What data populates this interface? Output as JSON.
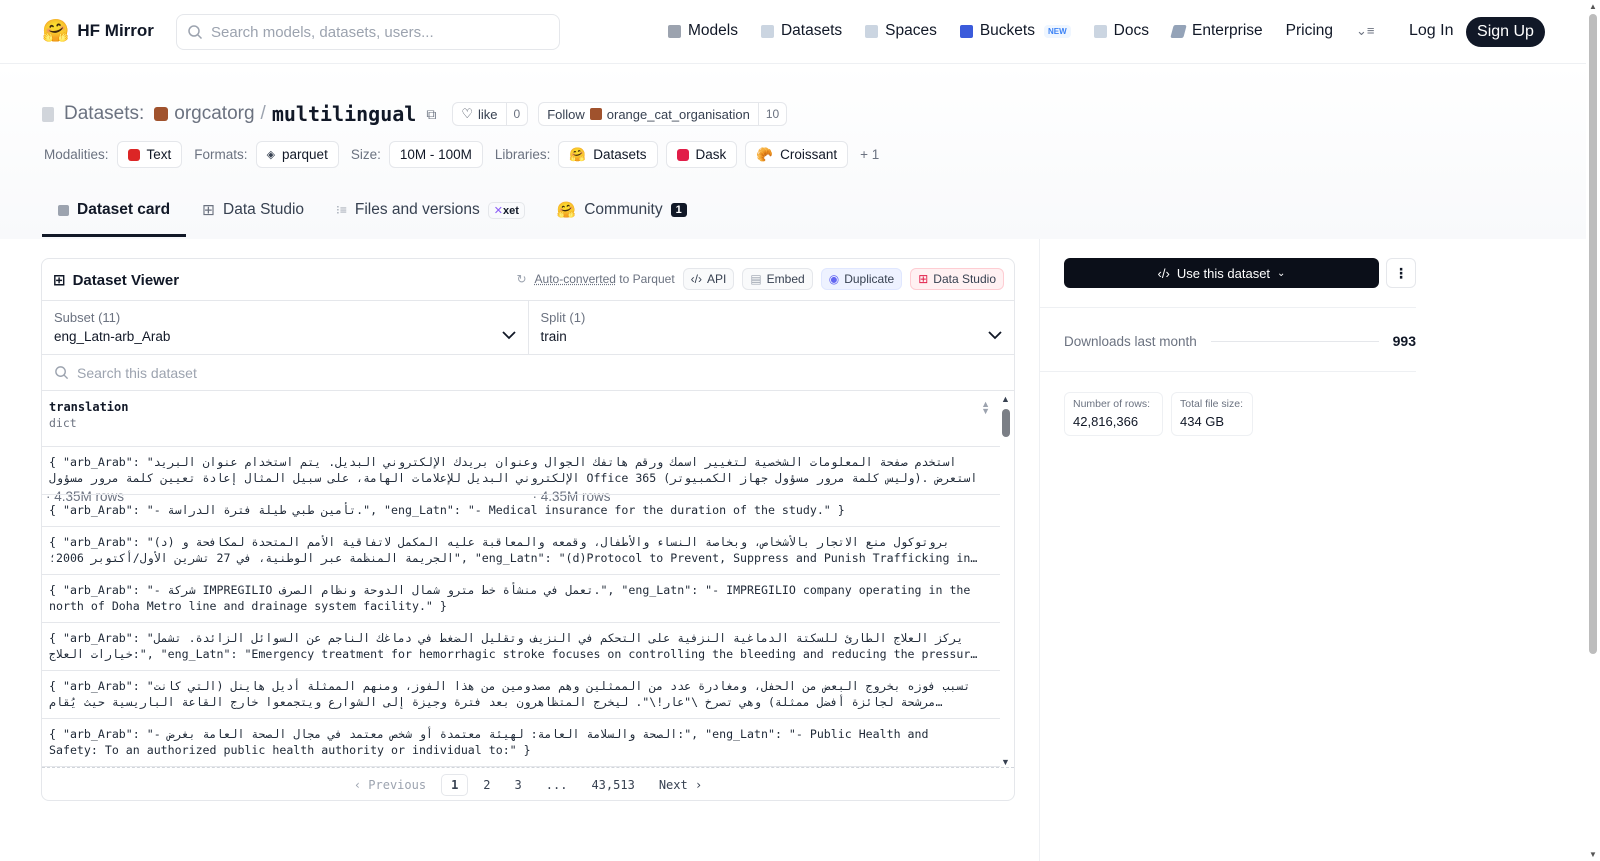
{
  "nav": {
    "brand": "HF Mirror",
    "search_placeholder": "Search models, datasets, users...",
    "items": [
      {
        "label": "Models",
        "icon": "models-icon",
        "color": "#9ca3af"
      },
      {
        "label": "Datasets",
        "icon": "datasets-icon",
        "color": "#9ca3af"
      },
      {
        "label": "Spaces",
        "icon": "spaces-icon",
        "color": "#9ca3af"
      },
      {
        "label": "Buckets",
        "icon": "buckets-icon",
        "color": "#3b5bdb"
      },
      {
        "label": "Docs",
        "icon": "docs-icon",
        "color": "#9ca3af"
      },
      {
        "label": "Enterprise",
        "icon": "enterprise-icon",
        "color": "#6b7280"
      },
      {
        "label": "Pricing"
      }
    ],
    "new_badge": "NEW",
    "login": "Log In",
    "signup": "Sign Up"
  },
  "header": {
    "label": "Datasets:",
    "org": "orgcatorg",
    "separator": "/",
    "name": "multilingual",
    "like_label": "like",
    "like_count": "0",
    "follow_label": "Follow",
    "follow_org": "orange_cat_organisation",
    "follow_count": "10",
    "modalities_label": "Modalities:",
    "modality": "Text",
    "formats_label": "Formats:",
    "format": "parquet",
    "size_label": "Size:",
    "size": "10M - 100M",
    "libraries_label": "Libraries:",
    "libraries": [
      "Datasets",
      "Dask",
      "Croissant"
    ],
    "more_libs": "+ 1"
  },
  "tabs": {
    "card": "Dataset card",
    "studio": "Data Studio",
    "files": "Files and versions",
    "xet": "xet",
    "community": "Community",
    "community_count": "1"
  },
  "viewer": {
    "title": "Dataset Viewer",
    "auto_converted": "Auto-converted",
    "to_parquet": "to Parquet",
    "api": "API",
    "embed": "Embed",
    "duplicate": "Duplicate",
    "data_studio": "Data Studio",
    "subset_label": "Subset (11)",
    "subset_value": "eng_Latn-arb_Arab",
    "subset_rows": "4.35M rows",
    "split_label": "Split (1)",
    "split_value": "train",
    "split_rows": "4.35M rows",
    "search_placeholder": "Search this dataset",
    "column_name": "translation",
    "column_type": "dict",
    "rows": [
      [
        "{ \"arb_Arab\": \"استخدم صفحة المعلومات الشخصية لتغيير اسمك ورقم هاتفك الجوال وعنوان بريدك الإلكتروني البديل. يتم استخدام عنوان البريد",
        "الإلكتروني البديل للإعلامات الهامة، على سبيل المثال إعادة تعيين كلمة مرور مسؤول Office 365 (وليس كلمة مرور مسؤول جهاز الكمبيوتر). استعرض"
      ],
      [
        "{ \"arb_Arab\": \"- تأمين طبي طيلة فترة الدراسة.\", \"eng_Latn\": \"- Medical insurance for the duration of the study.\" }"
      ],
      [
        "{ \"arb_Arab\": \"(د) بروتوكول منع الاتجار بالأشخاص، وبخاصة النساء والأطفال، وقمعه والمعاقبة عليه المكمل لاتفاقية الأمم المتحدة لمكافحة و",
        "الجريمة المنظمة عبر الوطنية، في 27 تشرين الأول/أكتوبر 2006؛\", \"eng_Latn\": \"(d)Protocol to Prevent, Suppress and Punish Trafficking in…"
      ],
      [
        "{ \"arb_Arab\": \"- شركة IMPREGILIO تعمل في منشأة خط مترو شمال الدوحة ونظام الصرف.\", \"eng_Latn\": \"- IMPREGILIO company operating in the",
        "north of Doha Metro line and drainage system facility.\" }"
      ],
      [
        "{ \"arb_Arab\": \"يركز العلاج الطارئ للسكتة الدماغية النزفية على التحكم في النزيف وتقليل الضغط في دماغك الناجم عن السوائل الزائدة. تشمل",
        "خيارات العلاج:\", \"eng_Latn\": \"Emergency treatment for hemorrhagic stroke focuses on controlling the bleeding and reducing the pressur…"
      ],
      [
        "{ \"arb_Arab\": \"تسبب فوزه بخروج البعض من الحفل، ومغادرة عدد من الممثلين وهم مصدومين من هذا الفوز، ومنهم الممثلة أديل هاينل (التي كانت",
        "مرشحة لجائزة أفضل ممثلة) وهي تصرخ \\\"عار!\\\". ليخرج المتظاهرون بعد فترة وجيزة إلى الشوارع ويتجمعوا خارج القاعة الباريسية حيث يُقام…"
      ],
      [
        "{ \"arb_Arab\": \"- الصحة والسلامة العامة: لهيئة معتمدة أو شخص معتمد في مجال الصحة العامة بغرض:\", \"eng_Latn\": \"- Public Health and",
        "Safety: To an authorized public health authority or individual to:\" }"
      ]
    ],
    "pager": {
      "prev": "Previous",
      "pages": [
        "1",
        "2",
        "3",
        "...",
        "43,513"
      ],
      "next": "Next"
    }
  },
  "sidebar": {
    "use_button": "Use this dataset",
    "downloads_label": "Downloads last month",
    "downloads_value": "993",
    "rows_label": "Number of rows:",
    "rows_value": "42,816,366",
    "size_label": "Total file size:",
    "size_value": "434 GB"
  }
}
